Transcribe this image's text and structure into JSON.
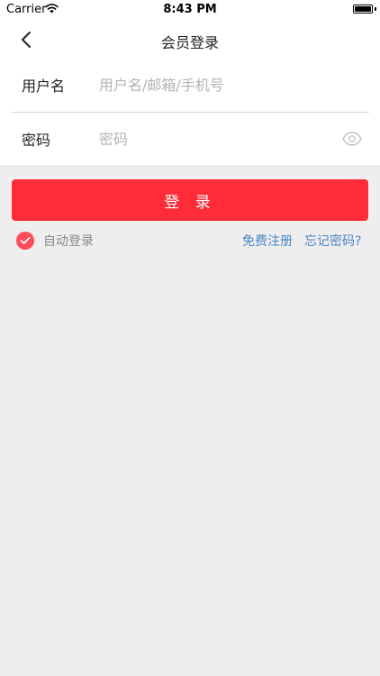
{
  "status_bar": {
    "carrier": "Carrier",
    "time": "8:43 PM",
    "wifi_icon": "wifi-icon",
    "battery_icon": "battery-icon"
  },
  "nav": {
    "back_icon": "chevron-left-icon",
    "title": "会员登录"
  },
  "form": {
    "username": {
      "label": "用户名",
      "placeholder": "用户名/邮箱/手机号",
      "value": ""
    },
    "password": {
      "label": "密码",
      "placeholder": "密码",
      "value": "",
      "toggle_icon": "eye-icon"
    }
  },
  "login_button": {
    "label": "登 录"
  },
  "auto_login": {
    "label": "自动登录",
    "checked": true
  },
  "links": {
    "register": "免费注册",
    "forgot": "忘记密码?"
  },
  "colors": {
    "accent": "#ff2b38",
    "link": "#4a86c5",
    "background": "#eeeeee"
  }
}
